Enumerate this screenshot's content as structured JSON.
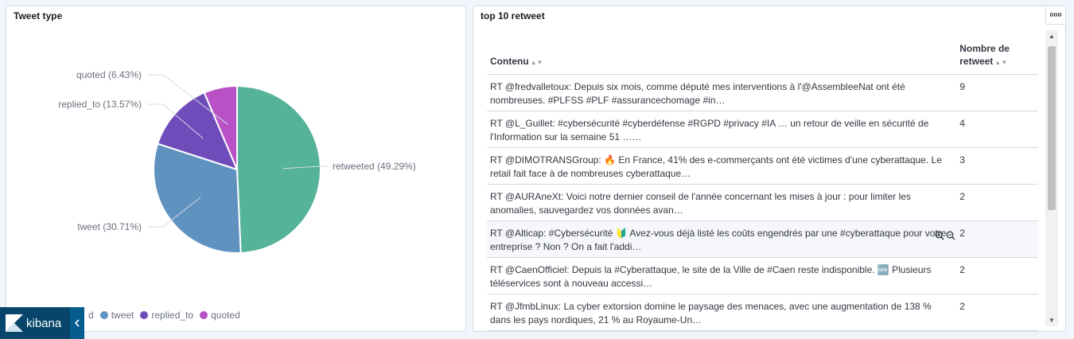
{
  "left_panel": {
    "title": "Tweet type"
  },
  "chart_data": {
    "type": "pie",
    "slices": [
      {
        "label": "retweeted",
        "display": "retweeted (49.29%)",
        "value": 49.29,
        "color": "#54b399"
      },
      {
        "label": "tweet",
        "display": "tweet (30.71%)",
        "value": 30.71,
        "color": "#6092c0"
      },
      {
        "label": "replied_to",
        "display": "replied_to (13.57%)",
        "value": 13.57,
        "color": "#6f4cba"
      },
      {
        "label": "quoted",
        "display": "quoted (6.43%)",
        "value": 6.43,
        "color": "#b950c6"
      }
    ],
    "legend_placement": "bottom-left"
  },
  "legend": {
    "items": [
      "retweeted",
      "tweet",
      "replied_to",
      "quoted"
    ],
    "visible_fragment": "d"
  },
  "kibana": {
    "label": "kibana"
  },
  "right_panel": {
    "title": "top 10 retweet",
    "columns": [
      "Contenu",
      "Nombre de retweet"
    ],
    "rows": [
      {
        "content": "RT @fredvalletoux: Depuis six mois, comme député mes interventions à l'@AssembleeNat ont été nombreuses. #PLFSS #PLF #assurancechomage #in…",
        "count": "9"
      },
      {
        "content": "RT @L_Guillet: #cybersécurité #cyberdéfense #RGPD #privacy #IA … un retour de veille en sécurité de l'Information sur la semaine 51 ……",
        "count": "4"
      },
      {
        "content": "RT @DIMOTRANSGroup: 🔥 En France, 41% des e-commerçants ont été victimes d'une cyberattaque. Le retail fait face à de nombreuses cyberattaque…",
        "count": "3"
      },
      {
        "content": "RT @AURAneXt: Voici notre dernier conseil de l'année concernant les mises à jour : pour limiter les anomalies, sauvegardez vos données avan…",
        "count": "2"
      },
      {
        "content": "RT @Alticap: #Cybersécurité 🔰 Avez-vous déjà listé les coûts engendrés par une #cyberattaque pour votre entreprise ? Non ? On a fait l'addi…",
        "count": "2"
      },
      {
        "content": "RT @CaenOfficiel: Depuis la #Cyberattaque, le site de la Ville de #Caen reste indisponible. 🆕 Plusieurs téléservices sont à nouveau accessi…",
        "count": "2"
      },
      {
        "content": "RT @JfmbLinux: La cyber extorsion domine le paysage des menaces, avec une augmentation de 138 % dans les pays nordiques, 21 % au Royaume-Un…",
        "count": "2"
      }
    ]
  }
}
